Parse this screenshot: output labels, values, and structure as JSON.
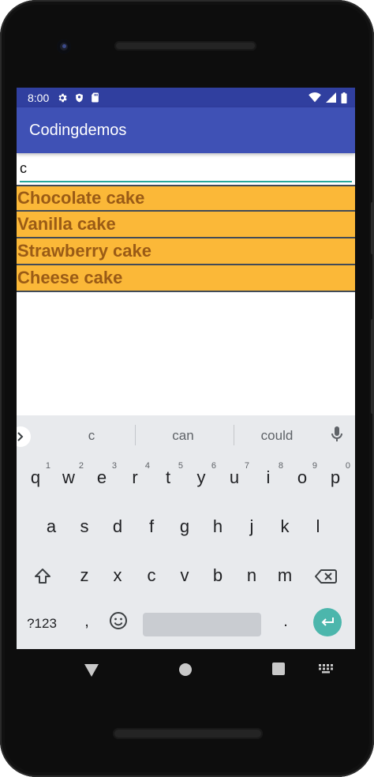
{
  "status_bar": {
    "time": "8:00"
  },
  "app": {
    "title": "Codingdemos"
  },
  "search": {
    "value": "c"
  },
  "list_items": [
    "Chocolate cake",
    "Vanilla cake",
    "Strawberry cake",
    "Cheese cake"
  ],
  "keyboard": {
    "suggestions": [
      "c",
      "can",
      "could"
    ],
    "row1": [
      "q",
      "w",
      "e",
      "r",
      "t",
      "y",
      "u",
      "i",
      "o",
      "p"
    ],
    "row1_hints": [
      "1",
      "2",
      "3",
      "4",
      "5",
      "6",
      "7",
      "8",
      "9",
      "0"
    ],
    "row2": [
      "a",
      "s",
      "d",
      "f",
      "g",
      "h",
      "j",
      "k",
      "l"
    ],
    "row3": [
      "z",
      "x",
      "c",
      "v",
      "b",
      "n",
      "m"
    ],
    "symbols_label": "?123",
    "comma": ",",
    "period": "."
  },
  "colors": {
    "status_bar": "#303f9f",
    "app_bar": "#3f51b5",
    "list_item_bg": "#fbb838",
    "list_item_text": "#9a5b16",
    "accent": "#4cb6ac"
  }
}
